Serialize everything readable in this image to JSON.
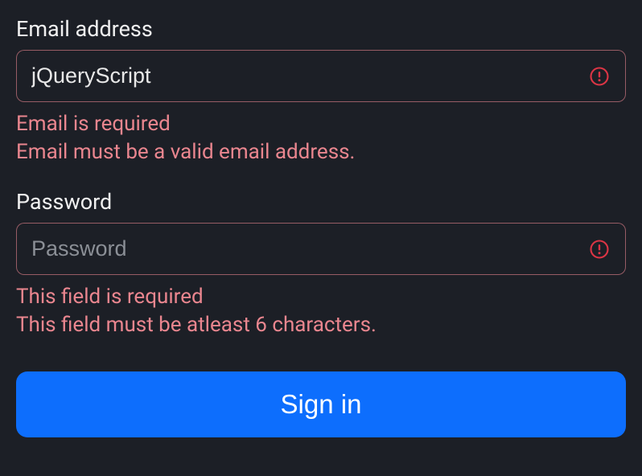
{
  "form": {
    "email": {
      "label": "Email address",
      "value": "jQueryScript",
      "errors": [
        "Email is required",
        "Email must be a valid email address."
      ]
    },
    "password": {
      "label": "Password",
      "placeholder": "Password",
      "value": "",
      "errors": [
        "This field is required",
        "This field must be atleast 6 characters."
      ]
    },
    "submit_label": "Sign in"
  },
  "colors": {
    "error": "#ea868f",
    "primary": "#0d6efd",
    "background": "#1c1f26"
  }
}
